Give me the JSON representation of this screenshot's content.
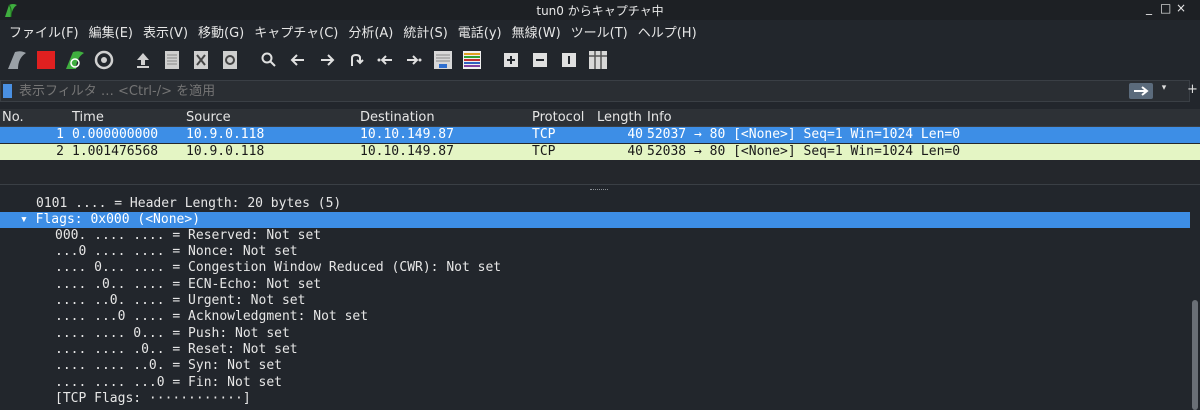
{
  "window": {
    "title": "tun0 からキャプチャ中",
    "controls": [
      "_",
      "□",
      "×"
    ]
  },
  "menu": [
    "ファイル(F)",
    "編集(E)",
    "表示(V)",
    "移動(G)",
    "キャプチャ(C)",
    "分析(A)",
    "統計(S)",
    "電話(y)",
    "無線(W)",
    "ツール(T)",
    "ヘルプ(H)"
  ],
  "filter": {
    "placeholder": "表示フィルタ … <Ctrl-/> を適用",
    "plus": "+"
  },
  "packet_list": {
    "columns": [
      "No.",
      "Time",
      "Source",
      "Destination",
      "Protocol",
      "Length",
      "Info"
    ],
    "rows": [
      {
        "no": "1",
        "time": "0.000000000",
        "source": "10.9.0.118",
        "destination": "10.10.149.87",
        "protocol": "TCP",
        "length": "40",
        "info": "52037 → 80 [<None>] Seq=1 Win=1024 Len=0"
      },
      {
        "no": "2",
        "time": "1.001476568",
        "source": "10.9.0.118",
        "destination": "10.10.149.87",
        "protocol": "TCP",
        "length": "40",
        "info": "52038 → 80 [<None>] Seq=1 Win=1024 Len=0"
      }
    ]
  },
  "details": {
    "header_length": "0101 .... = Header Length: 20 bytes (5)",
    "flags": "Flags: 0x000 (<None>)",
    "flag_lines": [
      "000. .... .... = Reserved: Not set",
      "...0 .... .... = Nonce: Not set",
      ".... 0... .... = Congestion Window Reduced (CWR): Not set",
      ".... .0.. .... = ECN-Echo: Not set",
      ".... ..0. .... = Urgent: Not set",
      ".... ...0 .... = Acknowledgment: Not set",
      ".... .... 0... = Push: Not set",
      ".... .... .0.. = Reset: Not set",
      ".... .... ..0. = Syn: Not set",
      ".... .... ...0 = Fin: Not set",
      "[TCP Flags: ············]"
    ]
  },
  "colors": {
    "selected": "#3d8ee6",
    "alt_row": "#e4f5c4",
    "background": "#22262c"
  }
}
